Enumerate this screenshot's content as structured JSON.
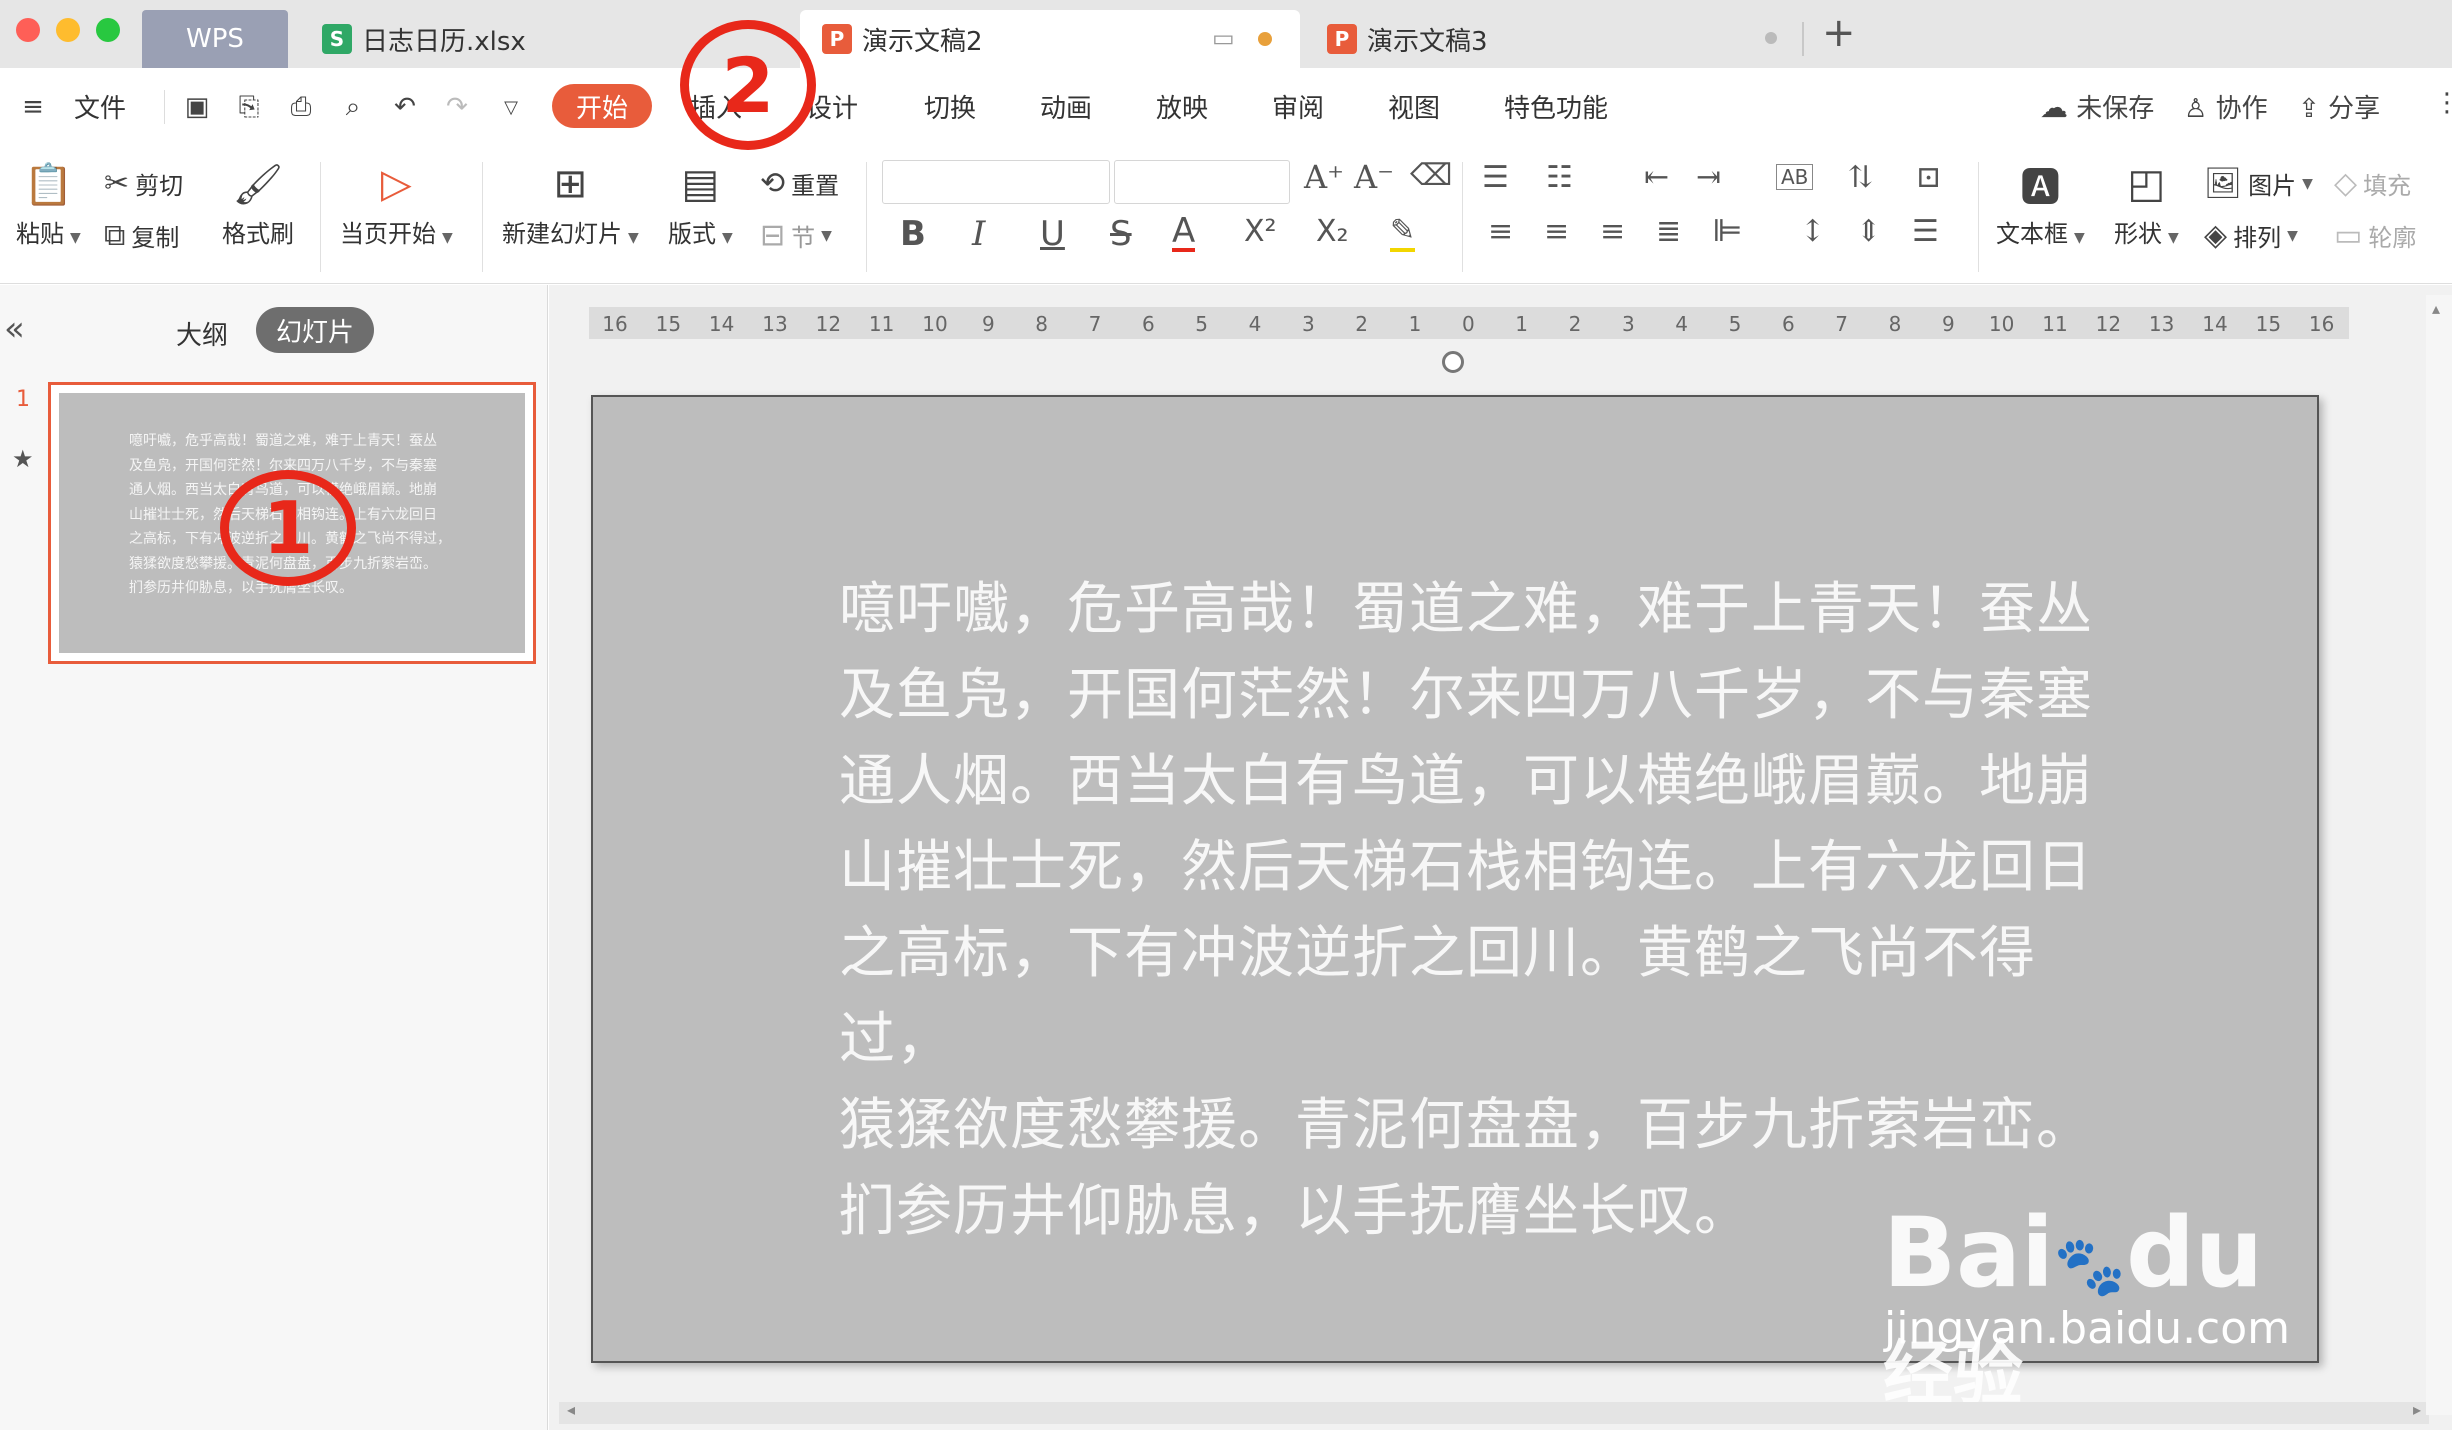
{
  "window": {
    "tabs": [
      {
        "label": "WPS"
      },
      {
        "label": "日志日历.xlsx",
        "icon": "S"
      },
      {
        "label": "演示文稿2",
        "icon": "P"
      },
      {
        "label": "演示文稿3",
        "icon": "P"
      }
    ],
    "new_tab": "+"
  },
  "menu": {
    "items": [
      "文件",
      "开始",
      "插入",
      "设计",
      "切换",
      "动画",
      "放映",
      "审阅",
      "视图",
      "特色功能"
    ],
    "right": {
      "unsaved": "未保存",
      "collab": "协作",
      "share": "分享"
    }
  },
  "ribbon": {
    "paste": "粘贴",
    "cut": "剪切",
    "copy": "复制",
    "format_painter": "格式刷",
    "play_current": "当页开始",
    "new_slide": "新建幻灯片",
    "layout": "版式",
    "reset": "重置",
    "section": "节",
    "textbox": "文本框",
    "shape": "形状",
    "picture": "图片",
    "arrange": "排列",
    "fill": "填充",
    "outline": "轮廓"
  },
  "panel": {
    "outline_tab": "大纲",
    "slides_tab": "幻灯片",
    "slide_number": "1"
  },
  "ruler": {
    "ticks": [
      "16",
      "15",
      "14",
      "13",
      "12",
      "11",
      "10",
      "9",
      "8",
      "7",
      "6",
      "5",
      "4",
      "3",
      "2",
      "1",
      "0",
      "1",
      "2",
      "3",
      "4",
      "5",
      "6",
      "7",
      "8",
      "9",
      "10",
      "11",
      "12",
      "13",
      "14",
      "15",
      "16"
    ]
  },
  "slide": {
    "lines": [
      "噫吁嚱，危乎高哉！蜀道之难，难于上青天！蚕丛",
      "及鱼凫，开国何茫然！尔来四万八千岁，不与秦塞",
      "通人烟。西当太白有鸟道，可以横绝峨眉巅。地崩",
      "山摧壮士死，然后天梯石栈相钩连。上有六龙回日",
      "之高标，下有冲波逆折之回川。黄鹤之飞尚不得过，",
      "猿猱欲度愁攀援。青泥何盘盘，百步九折萦岩峦。",
      "扪参历井仰胁息，以手抚膺坐长叹。"
    ]
  },
  "annotations": {
    "one": "1",
    "two": "2"
  },
  "watermark": {
    "brand": "Bai",
    "brand2": "du",
    "brand_cn": "经验",
    "url": "jingyan.baidu.com"
  },
  "colors": {
    "accent": "#e85c3b",
    "slide_bg": "#bdbdbd",
    "annotation": "#e8281a"
  }
}
